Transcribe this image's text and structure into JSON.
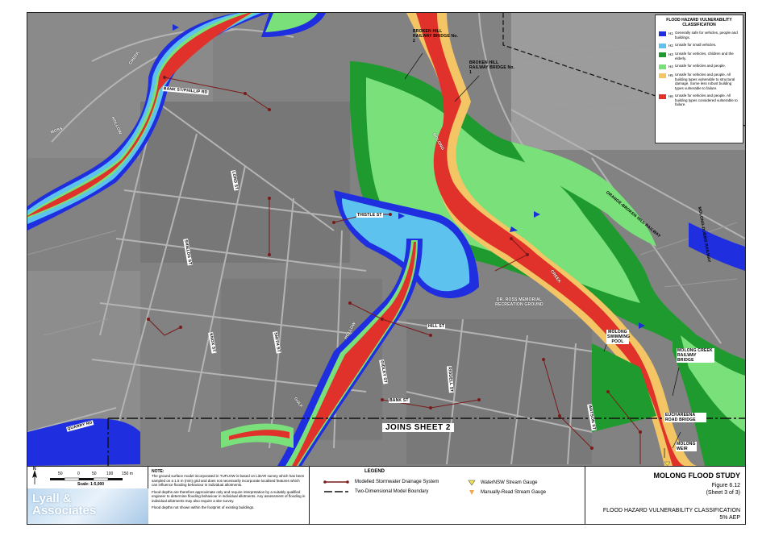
{
  "legend_classification": {
    "title": "FLOOD HAZARD VULNERABILITY CLASSIFICATION",
    "items": [
      {
        "code": "H1",
        "color": "#1f2fe0",
        "text": "Generally safe for vehicles, people and buildings."
      },
      {
        "code": "H2",
        "color": "#5ec2ee",
        "text": "Unsafe for small vehicles."
      },
      {
        "code": "H3",
        "color": "#1f9a2e",
        "text": "Unsafe for vehicles, children and the elderly."
      },
      {
        "code": "H4",
        "color": "#79e07a",
        "text": "Unsafe for vehicles and people."
      },
      {
        "code": "H5",
        "color": "#f3c565",
        "text": "Unsafe for vehicles and people. All building types vulnerable to structural damage. Some less robust building types vulnerable to failure."
      },
      {
        "code": "H6",
        "color": "#e0322b",
        "text": "Unsafe for vehicles and people. All building types considered vulnerable to failure."
      }
    ]
  },
  "map_labels": {
    "creek1": "CREEK",
    "hollow1": "HOLLOW",
    "moss": "MOSS",
    "bank_st": "BANK ST/PHILLIP RD",
    "railway1": "BROKEN HILL RAILWAY BRIDGE No. 2",
    "railway2": "BROKEN HILL RAILWAY BRIDGE No. 1",
    "molong": "MOLONG",
    "creek2": "CREEK",
    "ross": "DR. ROSS MEMORIAL RECREATION GROUND",
    "pool": "MOLONG SWIMMING POOL",
    "mc_bridge": "MOLONG CREEK RAILWAY BRIDGE",
    "euch": "EUCHAREENA ROAD BRIDGE",
    "weir": "MOLONG WEIR",
    "hollow2": "HOLLOW",
    "gulf": "GULF",
    "orange_broken_hill": "ORANGE-BROKEN HILL RAILWAY",
    "molong_dubbo": "MOLONG-DUBBO RAILWAY",
    "thistle": "THISTLE ST",
    "hill_st": "HILL ST",
    "gidley": "GIDLEY ST",
    "riddell": "RIDDELL ST",
    "watson": "WATSON ST",
    "bank_st2": "BANK ST",
    "smith": "SMITH ST",
    "lord": "LORD ST",
    "knox": "KNOX ST",
    "shields": "SHIELDS ST",
    "quarry": "QUARRY RD",
    "joins": "JOINS SHEET 2"
  },
  "scale": {
    "ticks": [
      "50",
      "0",
      "50",
      "100",
      "150 m"
    ],
    "text": "Scale: 1:5,000",
    "north": "N"
  },
  "note": {
    "heading": "NOTE:",
    "p1": "The ground surface model incorporated in TUFLOW is based on LiDAR survey which has been sampled on a 1.5 m (min) grid and does not necessarily incorporate localised features which can influence flooding behaviour in individual allotments.",
    "p2": "Flood depths are therefore approximate only and require interpretation by a suitably qualified engineer to determine flooding behaviour in individual allotments. Any assessment of flooding in individual allotments may also require a site survey.",
    "p3": "Flood depths not shown within the footprint of existing buildings."
  },
  "legend": {
    "title": "LEGEND",
    "stormwater": "Modelled Stormwater Drainage System",
    "boundary": "Two-Dimensional Model Boundary",
    "gauge1": "WaterNSW Stream Gauge",
    "gauge2": "Manually-Read Stream Gauge"
  },
  "title_block": {
    "study": "MOLONG FLOOD STUDY",
    "figure": "Figure 6.12",
    "sheet": "(Sheet 3 of 3)",
    "classification": "FLOOD HAZARD VULNERABILITY CLASSIFICATION",
    "aep": "5% AEP"
  },
  "logo": {
    "line1": "Lyall &",
    "line2": "Associates"
  }
}
